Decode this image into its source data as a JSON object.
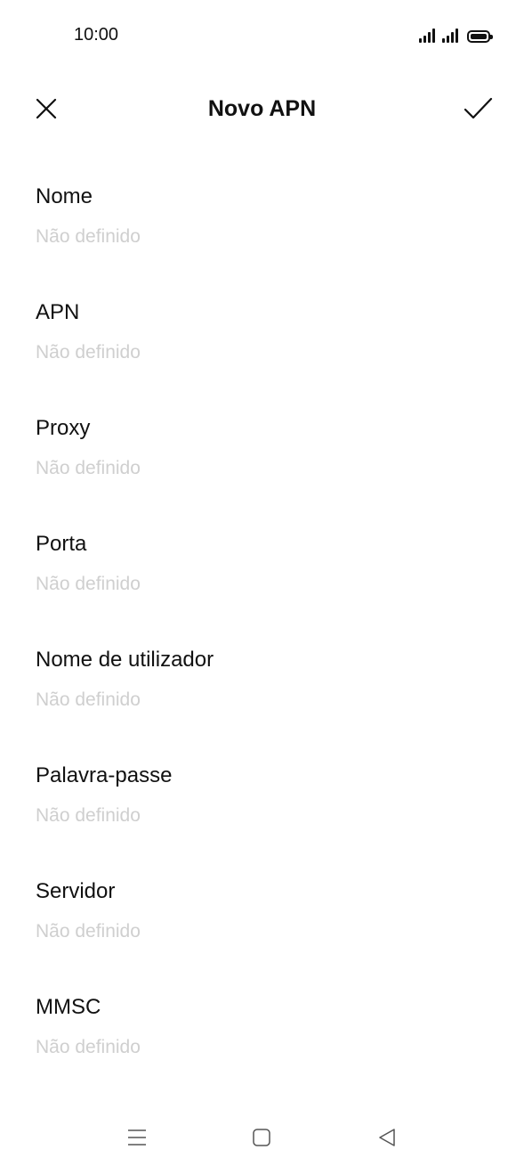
{
  "status_bar": {
    "time": "10:00"
  },
  "toolbar": {
    "title": "Novo APN"
  },
  "fields": [
    {
      "label": "Nome",
      "value": "Não definido"
    },
    {
      "label": "APN",
      "value": "Não definido"
    },
    {
      "label": "Proxy",
      "value": "Não definido"
    },
    {
      "label": "Porta",
      "value": "Não definido"
    },
    {
      "label": "Nome de utilizador",
      "value": "Não definido"
    },
    {
      "label": "Palavra-passe",
      "value": "Não definido"
    },
    {
      "label": "Servidor",
      "value": "Não definido"
    },
    {
      "label": "MMSC",
      "value": "Não definido"
    }
  ],
  "icons": {
    "close": "close-icon",
    "confirm": "checkmark-icon",
    "nav_menu": "menu-icon",
    "nav_home": "home-icon",
    "nav_back": "back-icon"
  },
  "colors": {
    "text": "#111111",
    "placeholder": "#cfcfcf",
    "background": "#ffffff"
  }
}
